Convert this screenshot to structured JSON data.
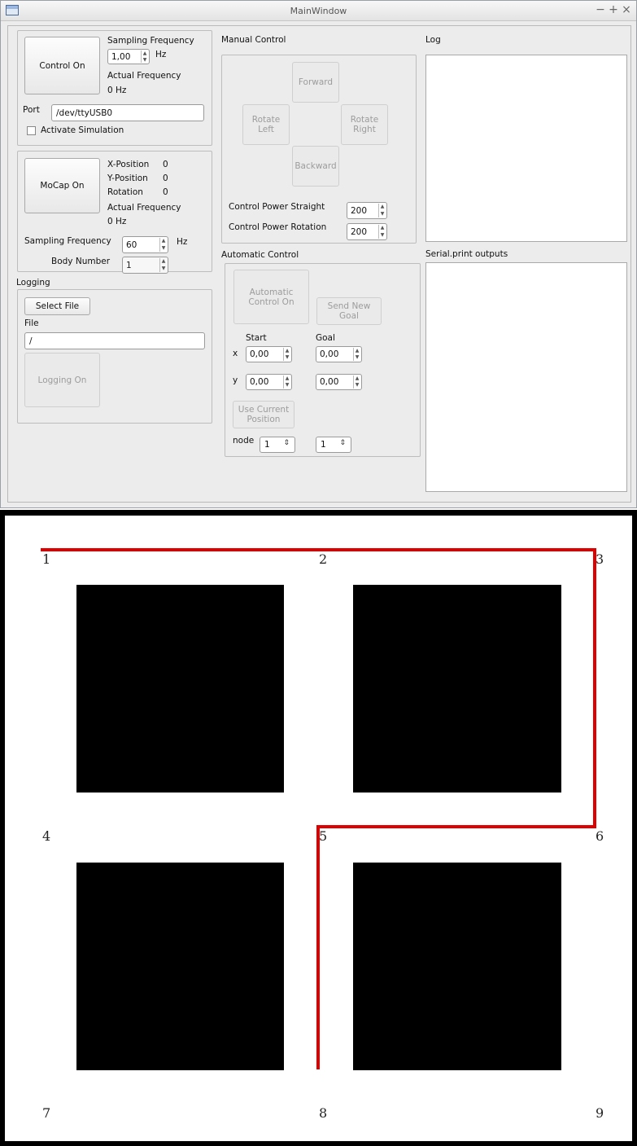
{
  "window": {
    "title": "MainWindow",
    "minimize": "−",
    "maximize": "+",
    "close": "×"
  },
  "control": {
    "button": "Control On",
    "sampling_frequency_label": "Sampling Frequency",
    "sampling_frequency_value": "1,00",
    "sampling_frequency_unit": "Hz",
    "actual_frequency_label": "Actual Frequency",
    "actual_frequency_value": "0 Hz",
    "port_label": "Port",
    "port_value": "/dev/ttyUSB0",
    "simulation_label": "Activate Simulation"
  },
  "mocap": {
    "button": "MoCap On",
    "x_label": "X-Position",
    "x_value": "0",
    "y_label": "Y-Position",
    "y_value": "0",
    "rot_label": "Rotation",
    "rot_value": "0",
    "actual_frequency_label": "Actual Frequency",
    "actual_frequency_value": "0 Hz",
    "sampling_frequency_label": "Sampling Frequency",
    "sampling_frequency_value": "60",
    "sampling_frequency_unit": "Hz",
    "body_number_label": "Body Number",
    "body_number_value": "1"
  },
  "logging": {
    "title": "Logging",
    "select_file": "Select File",
    "file_label": "File",
    "file_value": "/",
    "button": "Logging On"
  },
  "manual": {
    "title": "Manual Control",
    "forward": "Forward",
    "rotate_left": "Rotate\nLeft",
    "rotate_right": "Rotate\nRight",
    "backward": "Backward",
    "power_straight_label": "Control Power Straight",
    "power_straight_value": "200",
    "power_rotation_label": "Control Power Rotation",
    "power_rotation_value": "200"
  },
  "automatic": {
    "title": "Automatic Control",
    "button": "Automatic\nControl On",
    "send_goal": "Send New\nGoal",
    "start_label": "Start",
    "goal_label": "Goal",
    "x_label": "x",
    "y_label": "y",
    "start_x": "0,00",
    "start_y": "0,00",
    "goal_x": "0,00",
    "goal_y": "0,00",
    "use_current": "Use Current\nPosition",
    "node_label": "node",
    "node_start": "1",
    "node_goal": "1"
  },
  "log": {
    "title": "Log"
  },
  "serial": {
    "title": "Serial.print outputs"
  },
  "map": {
    "nodes": [
      "1",
      "2",
      "3",
      "4",
      "5",
      "6",
      "7",
      "8",
      "9"
    ],
    "path": [
      "1",
      "3",
      "6",
      "5",
      "8"
    ],
    "colors": {
      "path": "#e00000",
      "blocks": "#000000",
      "background": "#ffffff"
    }
  }
}
